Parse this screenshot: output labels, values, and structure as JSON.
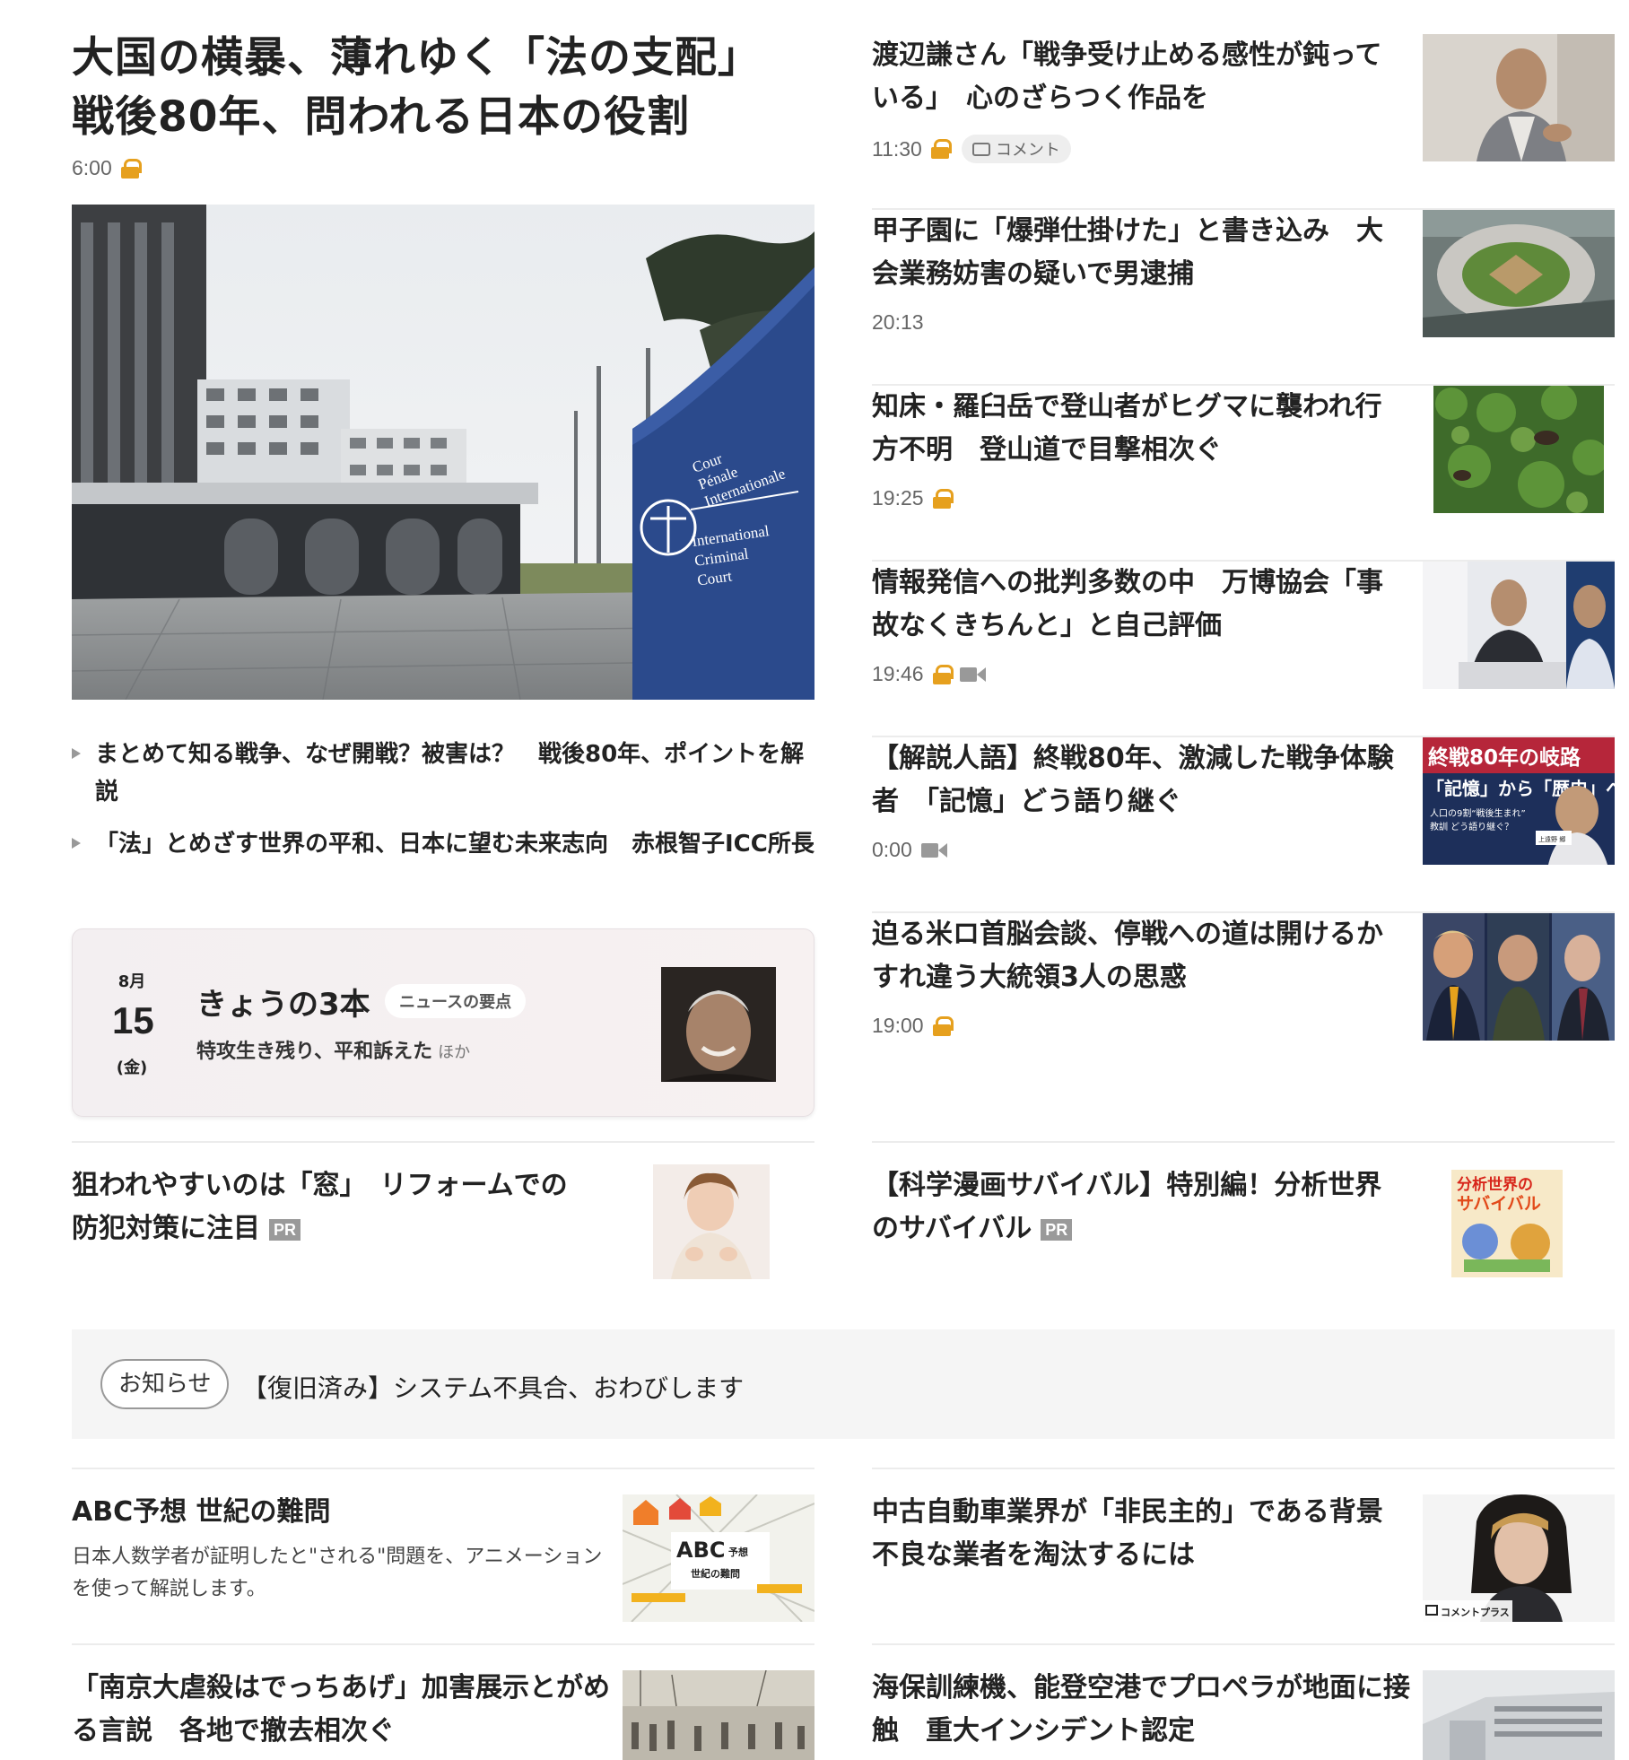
{
  "lead": {
    "title": "大国の横暴、薄れゆく「法の支配」　戦後80年、問われる日本の役割",
    "time": "6:00",
    "image_sign_text": {
      "l1": "Cour",
      "l2": "Pénale",
      "l3": "Internationale",
      "l4": "International",
      "l5": "Criminal",
      "l6": "Court"
    },
    "related": [
      "まとめて知る戦争、なぜ開戦？被害は？　戦後80年、ポイントを解説",
      "「法」とめざす世界の平和、日本に望む未来志向　赤根智子ICC所長"
    ]
  },
  "kyou": {
    "month": "8月",
    "day": "15",
    "dow": "(金)",
    "title": "きょうの3本",
    "badge": "ニュースの要点",
    "sub": "特攻生き残り、平和訴えた",
    "hoka": "ほか"
  },
  "right_items": [
    {
      "title": "渡辺謙さん「戦争受け止める感性が鈍っている」　心のざらつく作品を",
      "time": "11:30",
      "lock": true,
      "comment": "コメント"
    },
    {
      "title": "甲子園に「爆弾仕掛けた」と書き込み　大会業務妨害の疑いで男逮捕",
      "time": "20:13"
    },
    {
      "title": "知床・羅臼岳で登山者がヒグマに襲われ行方不明　登山道で目撃相次ぐ",
      "time": "19:25",
      "lock": true
    },
    {
      "title": "情報発信への批判多数の中　万博協会「事故なくきちんと」と自己評価",
      "time": "19:46",
      "lock": true,
      "video": true
    },
    {
      "title": "【解説人語】終戦80年、激減した戦争体験者　「記憶」どう語り継ぐ",
      "time": "0:00",
      "video": true,
      "thumb_text": {
        "l1": "終戦80年の岐路",
        "l2": "「記憶」から「歴史」へ",
        "l3": "人口の9割“戦後生まれ”",
        "l4": "教訓 どう語り継ぐ？",
        "l5": "上遠野 郷"
      }
    },
    {
      "title": "迫る米ロ首脳会談、停戦への道は開けるか　すれ違う大統領3人の思惑",
      "time": "19:00",
      "lock": true
    }
  ],
  "pr": {
    "left": {
      "title": "狙われやすいのは「窓」　リフォームでの防犯対策に注目",
      "badge": "PR"
    },
    "right": {
      "title": "【科学漫画サバイバル】特別編！分析世界のサバイバル",
      "badge": "PR",
      "thumb_text": {
        "l1": "分析世界の",
        "l2": "サバイバル"
      }
    }
  },
  "notice": {
    "pill": "お知らせ",
    "text": "【復旧済み】システム不具合、おわびします"
  },
  "bottom": {
    "abc": {
      "title": "ABC予想 世紀の難問",
      "desc": "日本人数学者が証明したと\"される\"問題を、アニメーションを使って解説します。",
      "thumb_text": {
        "l1": "ABC",
        "l2": "予想",
        "l3": "世紀の難問"
      }
    },
    "car": {
      "title": "中古自動車業界が「非民主的」である背景　不良な業者を淘汰するには",
      "thumb_badge": "コメントプラス"
    },
    "nanking": {
      "title": "「南京大虐殺はでっちあげ」加害展示とがめる言説　各地で撤去相次ぐ"
    },
    "coast": {
      "title": "海保訓練機、能登空港でプロペラが地面に接触　重大インシデント認定"
    }
  },
  "colors": {
    "lock": "#e6a01e",
    "text": "#222222",
    "meta": "#666666",
    "divider": "#ececec",
    "icc_blue": "#2b4a8c"
  }
}
